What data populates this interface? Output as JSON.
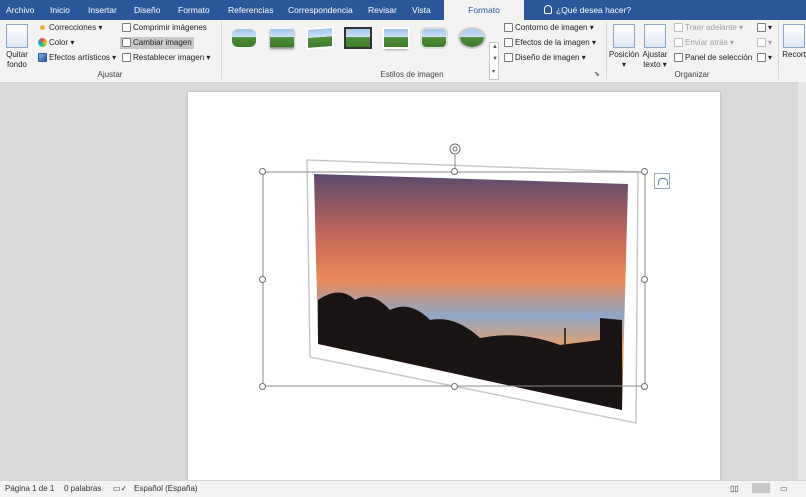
{
  "tabs": [
    {
      "label": "Archivo"
    },
    {
      "label": "Inicio"
    },
    {
      "label": "Insertar"
    },
    {
      "label": "Diseño"
    },
    {
      "label": "Formato"
    },
    {
      "label": "Referencias"
    },
    {
      "label": "Correspondencia"
    },
    {
      "label": "Revisar"
    },
    {
      "label": "Vista"
    },
    {
      "label": "Formato",
      "active": true
    }
  ],
  "tell_me": "¿Qué desea hacer?",
  "ribbon": {
    "ajustar": {
      "group_label": "Ajustar",
      "quitar_fondo": "Quitar fondo",
      "correcciones": "Correcciones",
      "color": "Color",
      "efectos_artisticos": "Efectos artísticos",
      "comprimir": "Comprimir imágenes",
      "cambiar": "Cambiar imagen",
      "restablecer": "Restablecer imagen"
    },
    "estilos": {
      "group_label": "Estilos de imagen",
      "contorno": "Contorno de imagen",
      "efectos": "Efectos de la imagen",
      "diseno": "Diseño de imagen"
    },
    "organizar": {
      "group_label": "Organizar",
      "posicion": "Posición",
      "ajustar_texto": "Ajustar texto",
      "traer_adelante": "Traer adelante",
      "enviar_atras": "Enviar atrás",
      "panel_seleccion": "Panel de selección"
    },
    "recortar": "Recort"
  },
  "status": {
    "page": "Página 1 de 1",
    "words": "0 palabras",
    "language": "Español (España)"
  },
  "colors": {
    "title_bar": "#2b579a",
    "ribbon_bg": "#f3f3f3",
    "canvas_bg": "#d9d9d9"
  }
}
